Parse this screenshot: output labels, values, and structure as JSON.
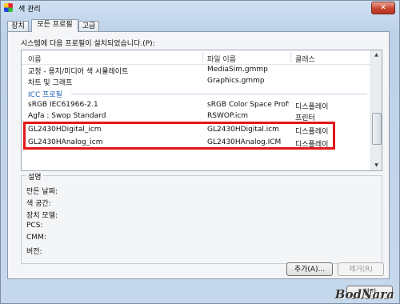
{
  "window": {
    "title": "색 관리",
    "close": "✕"
  },
  "tabs": [
    {
      "label": "장치"
    },
    {
      "label": "모든 프로필"
    },
    {
      "label": "고급"
    }
  ],
  "intro": "시스템에 다음 프로필이 설치되었습니다.(P):",
  "list": {
    "columns": [
      "이름",
      "파일 이름",
      "클래스"
    ],
    "rows": [
      {
        "name": "교정 - 용지/미디어 색 시뮬레이트",
        "file": "MediaSim.gmmp",
        "cls": ""
      },
      {
        "name": "차트 및 그래프",
        "file": "Graphics.gmmp",
        "cls": ""
      },
      {
        "name": "sRGB IEC61966-2.1",
        "file": "sRGB Color Space Profile.i...",
        "cls": "디스플레이"
      },
      {
        "name": "Agfa : Swop Standard",
        "file": "RSWOP.icm",
        "cls": "프린터"
      },
      {
        "name": "GL2430HDigital_icm",
        "file": "GL2430HDigital.icm",
        "cls": "디스플레이"
      },
      {
        "name": "GL2430HAnalog_icm",
        "file": "GL2430HAnalog.ICM",
        "cls": "디스플레이"
      }
    ],
    "group": "ICC 프로필"
  },
  "description": {
    "title": "설명",
    "fields": [
      "만든 날짜:",
      "색 공간:",
      "장치 모델:",
      "PCS:",
      "CMM:",
      "버전:"
    ]
  },
  "buttons": {
    "add": "추가(A)...",
    "remove": "제거(R)",
    "close": "닫기"
  },
  "watermark": "BodNara"
}
